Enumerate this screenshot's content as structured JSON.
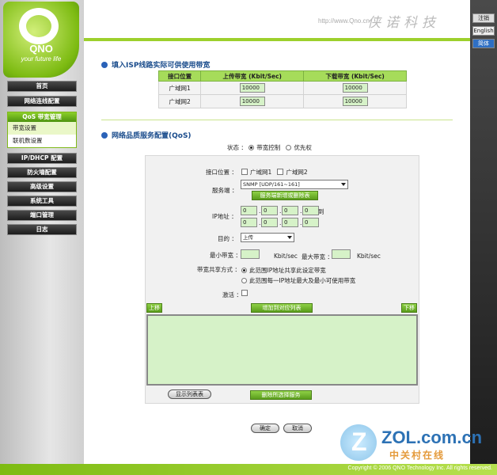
{
  "brand": {
    "name": "QNO",
    "slogan": "your future life",
    "url": "http://www.Qno.cn",
    "cn_name": "侠诺科技"
  },
  "lang": {
    "logout": "注销",
    "english": "English",
    "simplified": "简体"
  },
  "menu": {
    "home": "首页",
    "network": "网络连线配置",
    "qos": "QoS 带宽管理",
    "qos_items": [
      "带宽设置",
      "联机数设置"
    ],
    "ipdhcp": "IP/DHCP 配置",
    "firewall": "防火墙配置",
    "advanced": "高级设置",
    "tools": "系统工具",
    "port": "端口管理",
    "log": "日志"
  },
  "isp": {
    "title": "填入ISP线路实际可供使用带宽",
    "headers": [
      "接口位置",
      "上传带宽 (Kbit/Sec)",
      "下载带宽 (Kbit/Sec)"
    ],
    "rows": [
      {
        "name": "广域网1",
        "up": "10000",
        "down": "10000"
      },
      {
        "name": "广域网2",
        "up": "10000",
        "down": "10000"
      }
    ]
  },
  "qos": {
    "title": "网络品质服务配置(QoS)",
    "mode_label": "状态 ：",
    "mode_bandwidth": "带宽控制",
    "mode_priority": "优先权",
    "iface_label": "接口位置 ：",
    "wan1": "广域网1",
    "wan2": "广域网2",
    "service_label": "服务端 ：",
    "service_value": "SNMP [UDP/161~161]",
    "service_btn": "服务端新增或删除表",
    "ip_label": "IP地址 ：",
    "ip_start": [
      "0",
      "0",
      "0",
      "0"
    ],
    "ip_to": "到",
    "ip_end": [
      "0",
      "0",
      "0",
      "0"
    ],
    "dir_label": "目的 ：",
    "dir_value": "上传",
    "min_label": "最小带宽 ：",
    "max_label": "最大带宽 ：",
    "unit": "Kbit/sec",
    "share_label": "带宽共享方式 ：",
    "share_opt1": "此范围IP地址共享此设定带宽",
    "share_opt2": "此范围每一IP地址最大及最小可使用带宽",
    "enable_label": "激活 ：",
    "up_btn": "上移",
    "add_btn": "增加到对应列表",
    "down_btn": "下移",
    "show_table_btn": "显示列表表",
    "delete_btn": "删除所选择服务"
  },
  "footer": {
    "ok": "确定",
    "cancel": "取消",
    "copyright": "Copyright © 2006 QNO Technology Inc. All rights reserved.",
    "watermark_domain": "ZOL.com.cn",
    "watermark_cn": "中关村在线"
  }
}
